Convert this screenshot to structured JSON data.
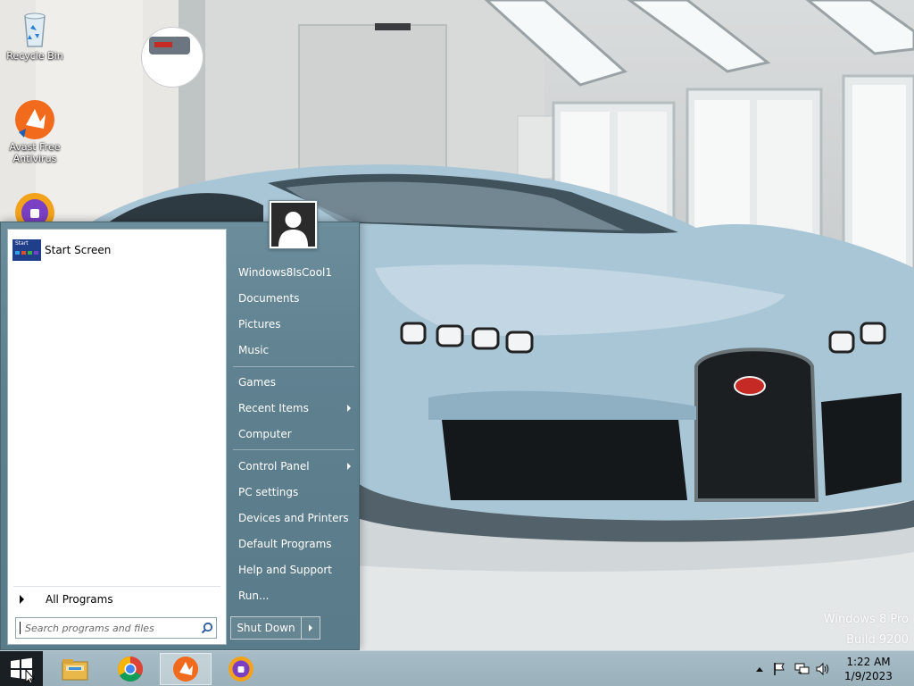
{
  "desktop": {
    "icons": [
      {
        "label": "Recycle Bin"
      },
      {
        "label_line1": "Avast Free",
        "label_line2": "Antivirus"
      }
    ],
    "watermark": {
      "line1": "Windows 8 Pro",
      "line2": "Build 9200"
    },
    "car_badge": "BUGATTI"
  },
  "start_menu": {
    "pinned": [
      {
        "label": "Start Screen",
        "tile_text": "Start"
      }
    ],
    "all_programs_label": "All Programs",
    "search": {
      "placeholder": "Search programs and files",
      "value": ""
    },
    "right_items": [
      {
        "label": "Windows8IsCool1",
        "submenu": false
      },
      {
        "label": "Documents",
        "submenu": false
      },
      {
        "label": "Pictures",
        "submenu": false
      },
      {
        "label": "Music",
        "submenu": false
      },
      {
        "label": "Games",
        "submenu": false
      },
      {
        "label": "Recent Items",
        "submenu": true
      },
      {
        "label": "Computer",
        "submenu": false
      },
      {
        "label": "Control Panel",
        "submenu": true
      },
      {
        "label": "PC settings",
        "submenu": false
      },
      {
        "label": "Devices and Printers",
        "submenu": false
      },
      {
        "label": "Default Programs",
        "submenu": false
      },
      {
        "label": "Help and Support",
        "submenu": false
      },
      {
        "label": "Run...",
        "submenu": false
      }
    ],
    "shutdown_label": "Shut Down"
  },
  "taskbar": {
    "apps": [
      {
        "icon": "file-explorer-icon",
        "active": false
      },
      {
        "icon": "chrome-icon",
        "active": false
      },
      {
        "icon": "avast-icon",
        "active": true
      },
      {
        "icon": "avast-secure-browser-icon",
        "active": false
      }
    ],
    "tray_icons": [
      "show-hidden-icons-chevron",
      "action-center-flag-icon",
      "network-icon",
      "volume-icon"
    ],
    "clock": {
      "time": "1:22 AM",
      "date": "1/9/2023"
    }
  },
  "colors": {
    "start_menu_bg": "#5e808f",
    "taskbar_bg": "#9ab1bc",
    "avast_orange": "#f26a1b"
  }
}
